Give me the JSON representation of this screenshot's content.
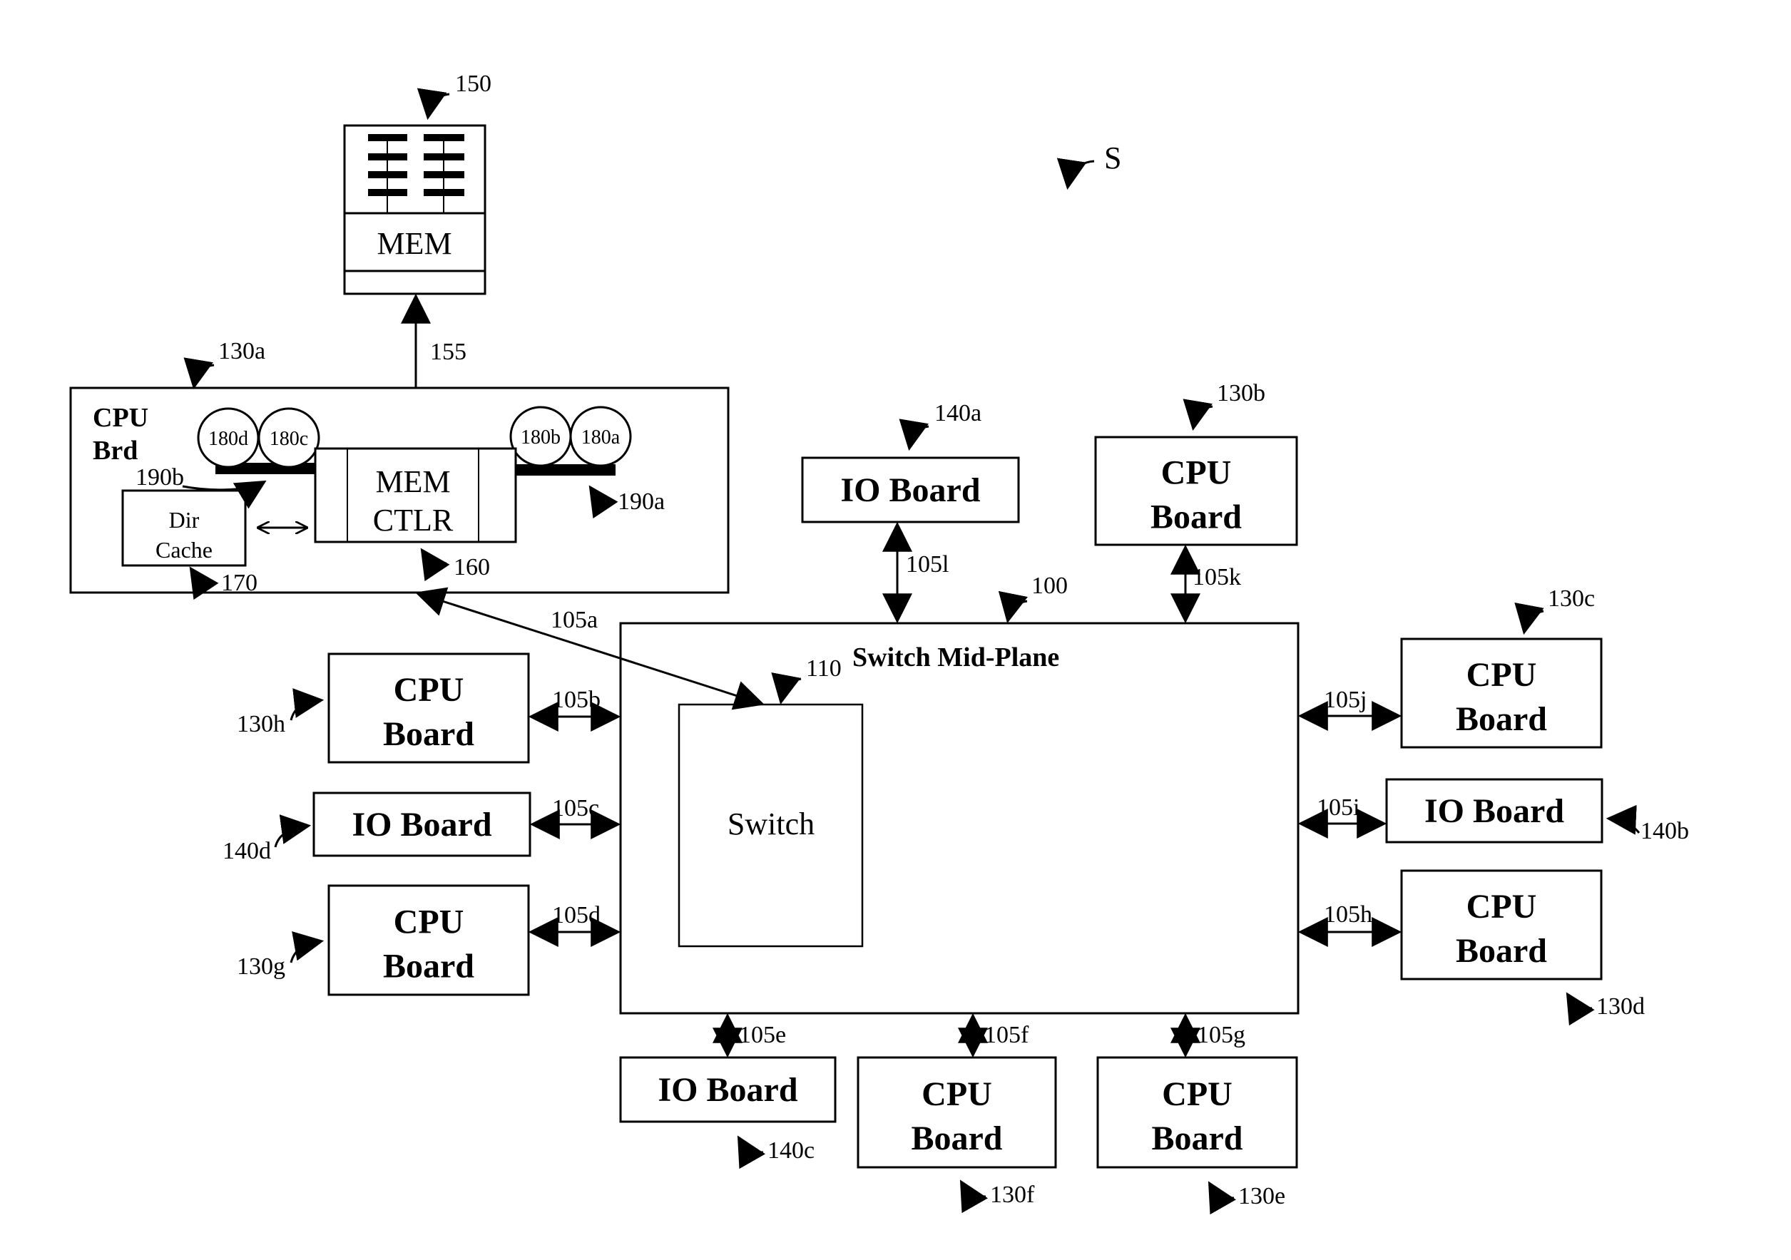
{
  "figure_label": "S",
  "memory": {
    "label": "MEM",
    "ref": "150"
  },
  "mem_link": {
    "ref": "155"
  },
  "cpu_board_detail": {
    "ref": "130a",
    "title_line1": "CPU",
    "title_line2": "Brd",
    "mem_ctlr": {
      "line1": "MEM",
      "line2": "CTLR",
      "ref": "160"
    },
    "dir_cache": {
      "line1": "Dir",
      "line2": "Cache",
      "ref": "170"
    },
    "processors": [
      "180d",
      "180c",
      "180b",
      "180a"
    ],
    "buses": {
      "left": "190b",
      "right": "190a"
    }
  },
  "midplane": {
    "title": "Switch Mid-Plane",
    "ref": "100"
  },
  "switch": {
    "label": "Switch",
    "ref": "110"
  },
  "boards": [
    {
      "id": "140a",
      "line1": "IO Board",
      "line2": "",
      "link": "105l"
    },
    {
      "id": "130b",
      "line1": "CPU",
      "line2": "Board",
      "link": "105k"
    },
    {
      "id": "130c",
      "line1": "CPU",
      "line2": "Board",
      "link": "105j"
    },
    {
      "id": "140b",
      "line1": "IO Board",
      "line2": "",
      "link": "105i"
    },
    {
      "id": "130d",
      "line1": "CPU",
      "line2": "Board",
      "link": "105h"
    },
    {
      "id": "130e",
      "line1": "CPU",
      "line2": "Board",
      "link": "105g"
    },
    {
      "id": "130f",
      "line1": "CPU",
      "line2": "Board",
      "link": "105f"
    },
    {
      "id": "140c",
      "line1": "IO Board",
      "line2": "",
      "link": "105e"
    },
    {
      "id": "130g",
      "line1": "CPU",
      "line2": "Board",
      "link": "105d"
    },
    {
      "id": "140d",
      "line1": "IO Board",
      "line2": "",
      "link": "105c"
    },
    {
      "id": "130h",
      "line1": "CPU",
      "line2": "Board",
      "link": "105b"
    }
  ],
  "cpu_to_switch_link": {
    "ref": "105a"
  }
}
